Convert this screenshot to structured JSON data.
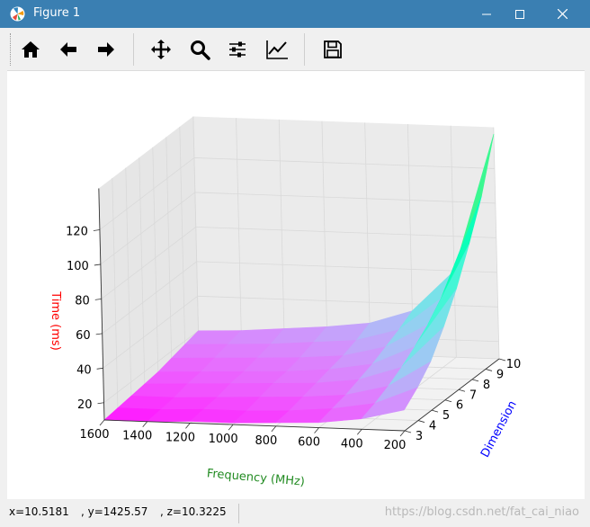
{
  "window": {
    "title": "Figure 1"
  },
  "toolbar": {
    "buttons": [
      {
        "name": "home-icon"
      },
      {
        "name": "back-arrow-icon"
      },
      {
        "name": "forward-arrow-icon"
      },
      {
        "name": "pan-icon"
      },
      {
        "name": "zoom-icon"
      },
      {
        "name": "configure-subplots-icon"
      },
      {
        "name": "edit-axis-icon"
      },
      {
        "name": "save-icon"
      }
    ]
  },
  "status": {
    "x": "x=10.5181",
    "y": ", y=1425.57",
    "z": ", z=10.3225",
    "watermark": "https://blog.csdn.net/fat_cai_niao"
  },
  "chart_data": {
    "type": "surface",
    "xlabel": "Frequency (MHz)",
    "ylabel": "Dimension",
    "zlabel": "Time (ms)",
    "x_ticks": [
      "1600",
      "1400",
      "1200",
      "1000",
      "800",
      "600",
      "400",
      "200"
    ],
    "y_ticks": [
      "3",
      "4",
      "5",
      "6",
      "7",
      "8",
      "9",
      "10"
    ],
    "z_ticks": [
      "20",
      "40",
      "60",
      "80",
      "100",
      "120"
    ],
    "x": [
      1600,
      1400,
      1200,
      1000,
      800,
      600,
      400,
      200
    ],
    "y": [
      3,
      4,
      5,
      6,
      7,
      8,
      9,
      10
    ],
    "z": [
      [
        10,
        10,
        11,
        11,
        12,
        13,
        16,
        22
      ],
      [
        11,
        11,
        12,
        12,
        13,
        15,
        19,
        29
      ],
      [
        12,
        12,
        13,
        14,
        15,
        17,
        23,
        38
      ],
      [
        13,
        14,
        15,
        16,
        17,
        20,
        28,
        52
      ],
      [
        14,
        15,
        16,
        17,
        19,
        23,
        34,
        68
      ],
      [
        16,
        17,
        18,
        19,
        21,
        27,
        41,
        88
      ],
      [
        18,
        19,
        20,
        22,
        24,
        31,
        50,
        110
      ],
      [
        20,
        21,
        23,
        25,
        28,
        36,
        60,
        140
      ]
    ],
    "colormap": "rainbow",
    "xlabel_color": "#228b22",
    "ylabel_color": "#0000ff",
    "zlabel_color": "#ff0000",
    "grid": true
  }
}
